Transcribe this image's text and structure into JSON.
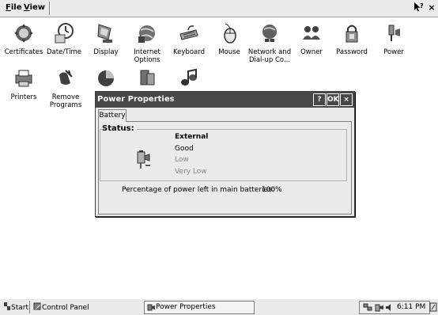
{
  "menubar": {
    "file_label": "File",
    "view_label": "View",
    "help_label": "?",
    "close_label": "×"
  },
  "desktop": {
    "icons": [
      {
        "label": "Certificates"
      },
      {
        "label": "Date/Time"
      },
      {
        "label": "Display"
      },
      {
        "label": "Internet Options"
      },
      {
        "label": "Keyboard"
      },
      {
        "label": "Mouse"
      },
      {
        "label": "Network and Dial-up Co..."
      },
      {
        "label": "Owner"
      },
      {
        "label": "Password"
      },
      {
        "label": "Power"
      },
      {
        "label": "Printers"
      },
      {
        "label": "Remove Programs"
      },
      {
        "label": ""
      },
      {
        "label": ""
      },
      {
        "label": ""
      }
    ]
  },
  "dialog": {
    "title": "Power Properties",
    "help_label": "?",
    "ok_label": "OK",
    "close_label": "×",
    "tab_label": "Battery",
    "status_label": "Status:",
    "status_items": [
      {
        "label": "External",
        "state": "active"
      },
      {
        "label": "Good",
        "state": "normal"
      },
      {
        "label": "Low",
        "state": "dim"
      },
      {
        "label": "Very Low",
        "state": "dim"
      }
    ],
    "percent_label": "Percentage of power left in main batteries:",
    "percent_value": "100%"
  },
  "taskbar": {
    "start_label": "Start",
    "control_panel_label": "Control Panel",
    "task_label": "Power Properties",
    "clock": "6:11 PM"
  },
  "colors": {
    "titlebar": "#484848",
    "window_bg": "#ebebeb",
    "dim_text": "#8a8a8a"
  }
}
